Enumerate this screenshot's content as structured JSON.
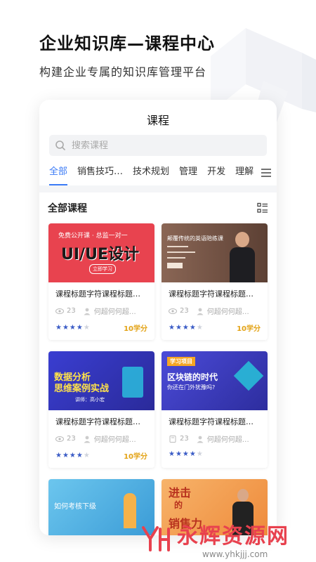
{
  "hero": {
    "title": "企业知识库—课程中心",
    "subtitle": "构建企业专属的知识库管理平台"
  },
  "screen": {
    "title": "课程",
    "search_placeholder": "搜索课程",
    "tabs": [
      "全部",
      "销售技巧…",
      "技术规划",
      "管理",
      "开发",
      "理解"
    ],
    "active_tab": "全部",
    "section_title": "全部课程"
  },
  "courses": [
    {
      "title": "课程标题字符课程标题字…",
      "views": "23",
      "author": "何超何何超…",
      "score": "10学分",
      "stars": 4,
      "thumb": {
        "line1": "免费公开课 · 总监一对一",
        "line2": "UI/UE设计",
        "line3": "立即学习",
        "bg": "#e8434f"
      }
    },
    {
      "title": "课程标题字符课程标题字…",
      "views": "23",
      "author": "何超何何超…",
      "score": "10学分",
      "stars": 4,
      "thumb": {
        "line1": "颠覆传统的英语陪练课",
        "line2": "",
        "line3": "",
        "bg": "#7a5a4c"
      }
    },
    {
      "title": "课程标题字符课程标题字…",
      "views": "23",
      "author": "何超何何超…",
      "score": "10学分",
      "stars": 4,
      "thumb": {
        "line1": "数据分析",
        "line2": "思维案例实战",
        "line3": "讲师：高小宏",
        "bg": "#3a3ed1"
      }
    },
    {
      "title": "课程标题字符课程标题字…",
      "views": "23",
      "author": "何超何何超…",
      "score": "",
      "stars": 4,
      "thumb": {
        "line1": "学习项目",
        "line2": "区块链的时代",
        "line3": "你还在门外犹豫吗?",
        "bg": "#3b3cc8"
      }
    },
    {
      "title": "",
      "views": "",
      "author": "",
      "score": "",
      "stars": 0,
      "thumb": {
        "line1": "如何考核下级",
        "line2": "",
        "line3": "",
        "bg": "#58b6e6"
      }
    },
    {
      "title": "",
      "views": "",
      "author": "",
      "score": "",
      "stars": 0,
      "thumb": {
        "line1": "进击",
        "line2": "的",
        "line3": "销售力",
        "bg": "#f2a25c"
      }
    }
  ],
  "watermark": {
    "text": "永辉资源网",
    "url": "www.yhkjjj.com"
  },
  "colors": {
    "accent": "#3b7bf6",
    "score": "#e3a316",
    "star": "#3b5cc6"
  }
}
